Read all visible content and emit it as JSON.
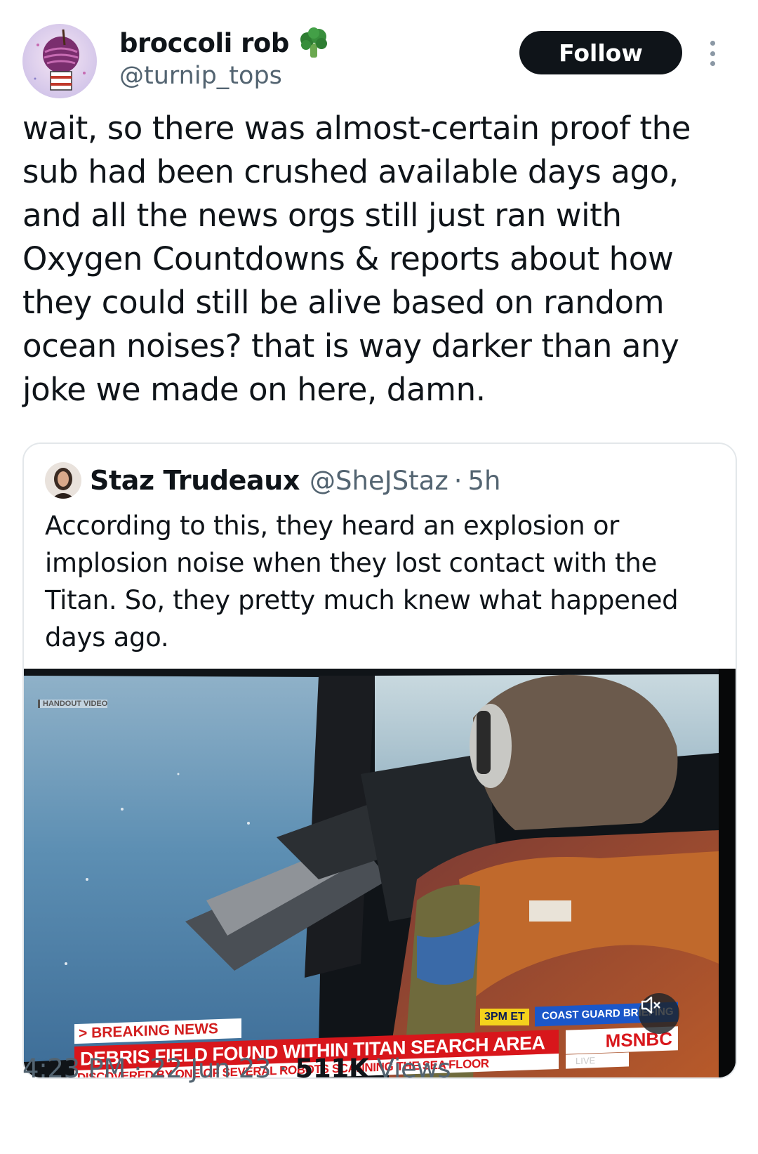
{
  "tweet": {
    "author": {
      "display_name": "broccoli rob",
      "handle": "@turnip_tops",
      "emoji_icon": "broccoli-emoji"
    },
    "follow_label": "Follow",
    "text": "wait, so there was almost-certain proof the sub had been crushed available days ago, and all the news orgs still just ran with Oxygen Countdowns & reports about how they could still be alive based on random ocean noises? that is way darker than any joke we made on here, damn.",
    "time": "4:23 PM",
    "date": "22 Jun 23",
    "views_count": "511K",
    "views_label": "Views",
    "separator": "·"
  },
  "quoted_tweet": {
    "display_name": "Staz Trudeaux",
    "handle": "@SheJStaz",
    "separator": "·",
    "time": "5h",
    "text": "According to this, they heard an explosion or implosion noise when they lost contact with the Titan. So, they pretty much knew what happened days ago.",
    "media": {
      "handout_label": "HANDOUT VIDEO",
      "breaking_label": "> BREAKING NEWS",
      "time_label": "3PM ET",
      "briefing_label": "COAST GUARD BRIEFING",
      "headline": "DEBRIS FIELD FOUND WITHIN TITAN SEARCH AREA",
      "subline": "DISCOVERED BY ONE OF SEVERAL ROBOTS SCANNING THE SEA FLOOR",
      "network": "MSNBC",
      "live_label": "LIVE"
    }
  },
  "colors": {
    "text": "#0f1419",
    "secondary": "#536471",
    "follow_bg": "#0f1419",
    "border": "#e3e7ea",
    "news_red": "#d8161b",
    "news_blue": "#1b57c9",
    "news_yellow": "#f4d21c"
  }
}
